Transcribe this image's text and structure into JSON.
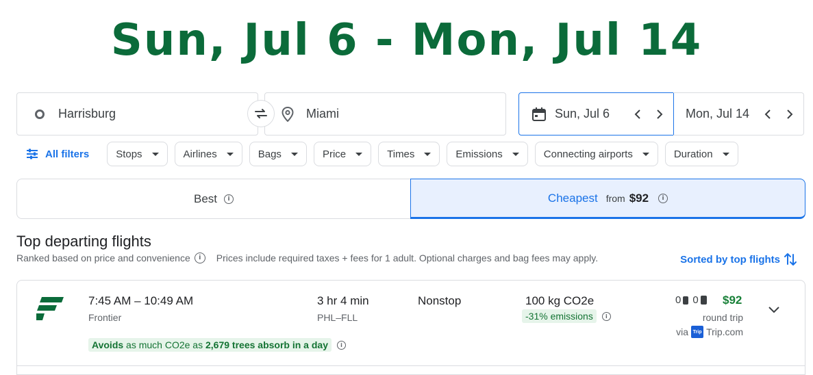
{
  "banner": {
    "dates_text": "Sun, Jul 6 - Mon, Jul 14"
  },
  "search": {
    "origin": "Harrisburg",
    "destination": "Miami",
    "depart_date": "Sun, Jul 6",
    "return_date": "Mon, Jul 14",
    "icons": {
      "origin": "origin-ring-icon",
      "destination": "map-pin-icon",
      "swap": "swap-icon",
      "calendar": "calendar-icon"
    }
  },
  "filters": {
    "all_filters_label": "All filters",
    "chips": [
      "Stops",
      "Airlines",
      "Bags",
      "Price",
      "Times",
      "Emissions",
      "Connecting airports",
      "Duration"
    ]
  },
  "sort_tabs": {
    "best_label": "Best",
    "cheapest_label": "Cheapest",
    "cheapest_from": "from",
    "cheapest_price": "$92"
  },
  "results": {
    "title": "Top departing flights",
    "subtitle": "Ranked based on price and convenience",
    "price_note": "Prices include required taxes + fees for 1 adult. Optional charges and bag fees may apply.",
    "sorted_label": "Sorted by top flights"
  },
  "flights": [
    {
      "times": "7:45 AM – 10:49 AM",
      "airline": "Frontier",
      "duration": "3 hr 4 min",
      "route": "PHL–FLL",
      "stops": "Nonstop",
      "co2": "100 kg CO2e",
      "emissions_badge": "-31% emissions",
      "carry_on_count": "0",
      "checked_bag_count": "0",
      "price": "$92",
      "trip_type": "round trip",
      "via_prefix": "via",
      "via_logo_text": "Trip",
      "via_site": "Trip.com",
      "avoid_lead": "Avoids",
      "avoid_mid": "as much CO2e as",
      "avoid_strong": "2,679 trees absorb in a day",
      "colors": {
        "airline_logo": "#0b6b3a",
        "price": "#188038"
      }
    }
  ],
  "colors": {
    "banner": "#0b6b3a",
    "accent": "#1a73e8",
    "green_badge_bg": "#e6f4ea",
    "green_text": "#137333"
  }
}
